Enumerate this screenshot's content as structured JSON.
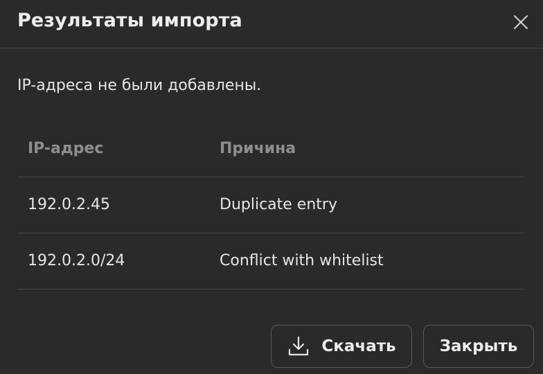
{
  "dialog": {
    "title": "Результаты импорта",
    "close_icon": "close-icon",
    "message": "IP-адреса не были добавлены."
  },
  "table": {
    "headers": [
      "IP-адрес",
      "Причина"
    ],
    "rows": [
      {
        "ip": "192.0.2.45",
        "reason": "Duplicate entry"
      },
      {
        "ip": "192.0.2.0/24",
        "reason": "Conflict with whitelist"
      }
    ]
  },
  "footer": {
    "download_label": "Скачать",
    "download_icon": "download-icon",
    "close_label": "Закрыть"
  },
  "colors": {
    "background": "#2a2a2a",
    "divider": "#474747",
    "header_text": "#8e8e8e",
    "text": "#e6e6e6"
  }
}
